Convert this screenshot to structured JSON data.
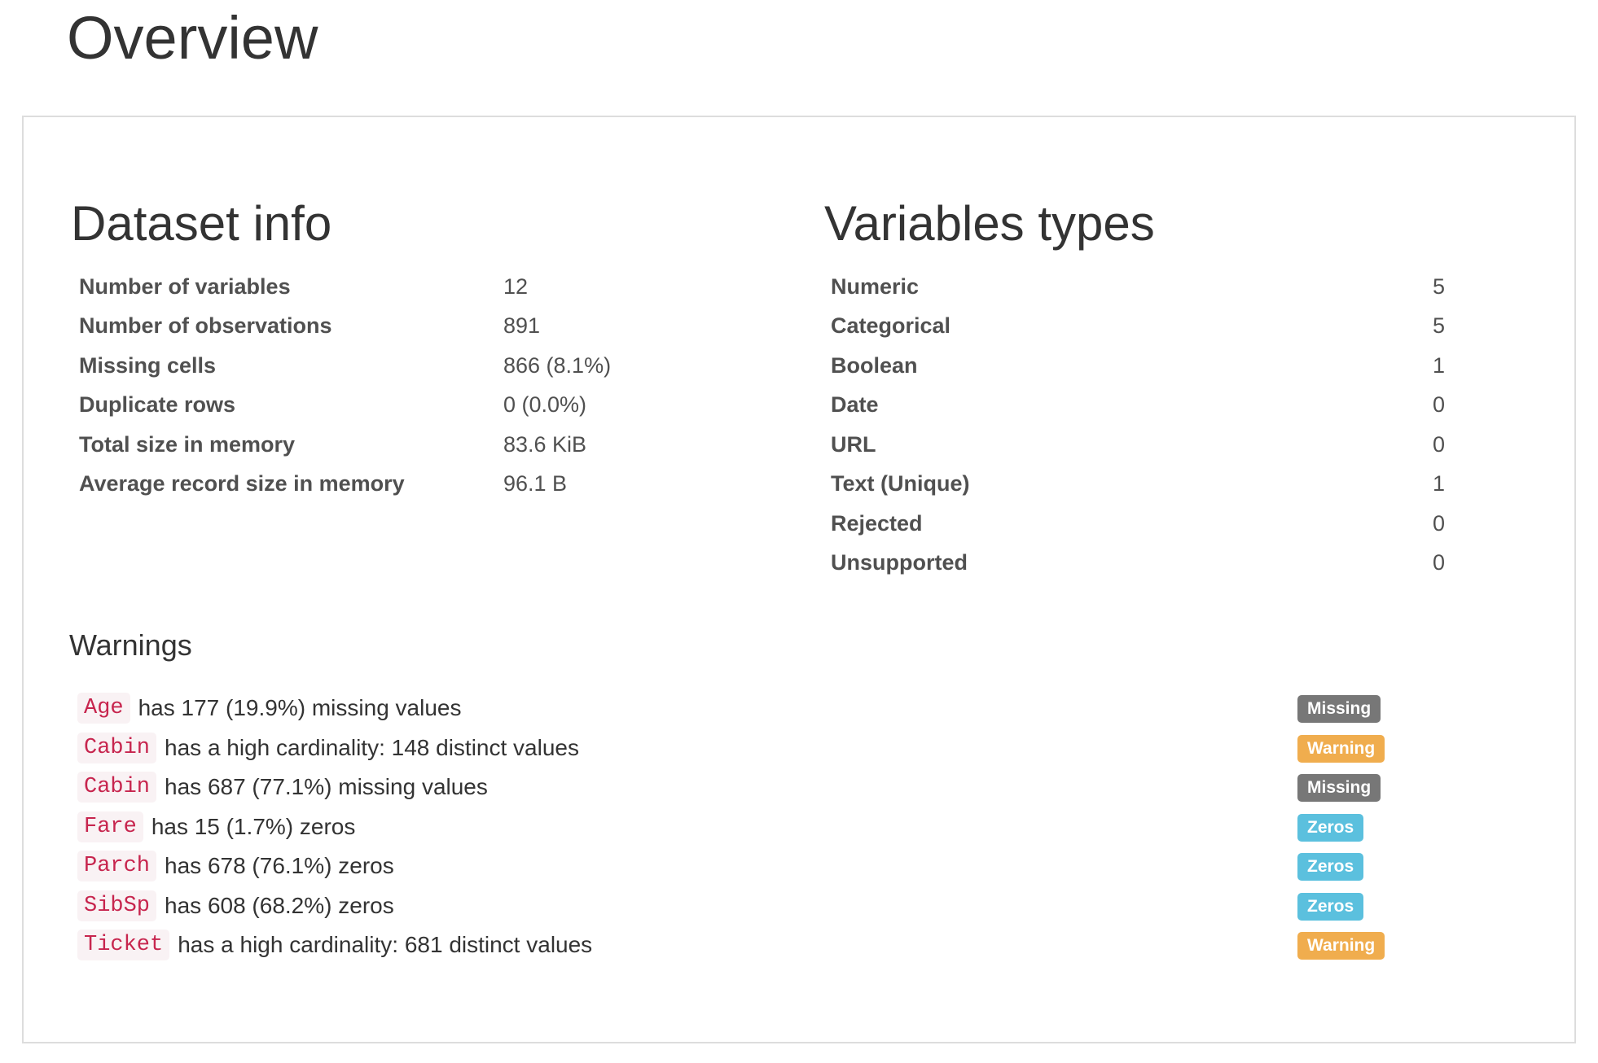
{
  "page": {
    "title": "Overview"
  },
  "dataset_info": {
    "title": "Dataset info",
    "rows": [
      {
        "label": "Number of variables",
        "value": "12"
      },
      {
        "label": "Number of observations",
        "value": "891"
      },
      {
        "label": "Missing cells",
        "value": "866 (8.1%)"
      },
      {
        "label": "Duplicate rows",
        "value": "0 (0.0%)"
      },
      {
        "label": "Total size in memory",
        "value": "83.6 KiB"
      },
      {
        "label": "Average record size in memory",
        "value": "96.1 B"
      }
    ]
  },
  "variables_types": {
    "title": "Variables types",
    "rows": [
      {
        "label": "Numeric",
        "value": "5"
      },
      {
        "label": "Categorical",
        "value": "5"
      },
      {
        "label": "Boolean",
        "value": "1"
      },
      {
        "label": "Date",
        "value": "0"
      },
      {
        "label": "URL",
        "value": "0"
      },
      {
        "label": "Text (Unique)",
        "value": "1"
      },
      {
        "label": "Rejected",
        "value": "0"
      },
      {
        "label": "Unsupported",
        "value": "0"
      }
    ]
  },
  "warnings": {
    "title": "Warnings",
    "items": [
      {
        "variable": "Age",
        "text": "has 177 (19.9%) missing values",
        "badge": "Missing",
        "badge_color": "#777777"
      },
      {
        "variable": "Cabin",
        "text": "has a high cardinality: 148 distinct values",
        "badge": "Warning",
        "badge_color": "#f0ad4e"
      },
      {
        "variable": "Cabin",
        "text": "has 687 (77.1%) missing values",
        "badge": "Missing",
        "badge_color": "#777777"
      },
      {
        "variable": "Fare",
        "text": "has 15 (1.7%) zeros",
        "badge": "Zeros",
        "badge_color": "#5bc0de"
      },
      {
        "variable": "Parch",
        "text": "has 678 (76.1%) zeros",
        "badge": "Zeros",
        "badge_color": "#5bc0de"
      },
      {
        "variable": "SibSp",
        "text": "has 608 (68.2%) zeros",
        "badge": "Zeros",
        "badge_color": "#5bc0de"
      },
      {
        "variable": "Ticket",
        "text": "has a high cardinality: 681 distinct values",
        "badge": "Warning",
        "badge_color": "#f0ad4e"
      }
    ]
  }
}
